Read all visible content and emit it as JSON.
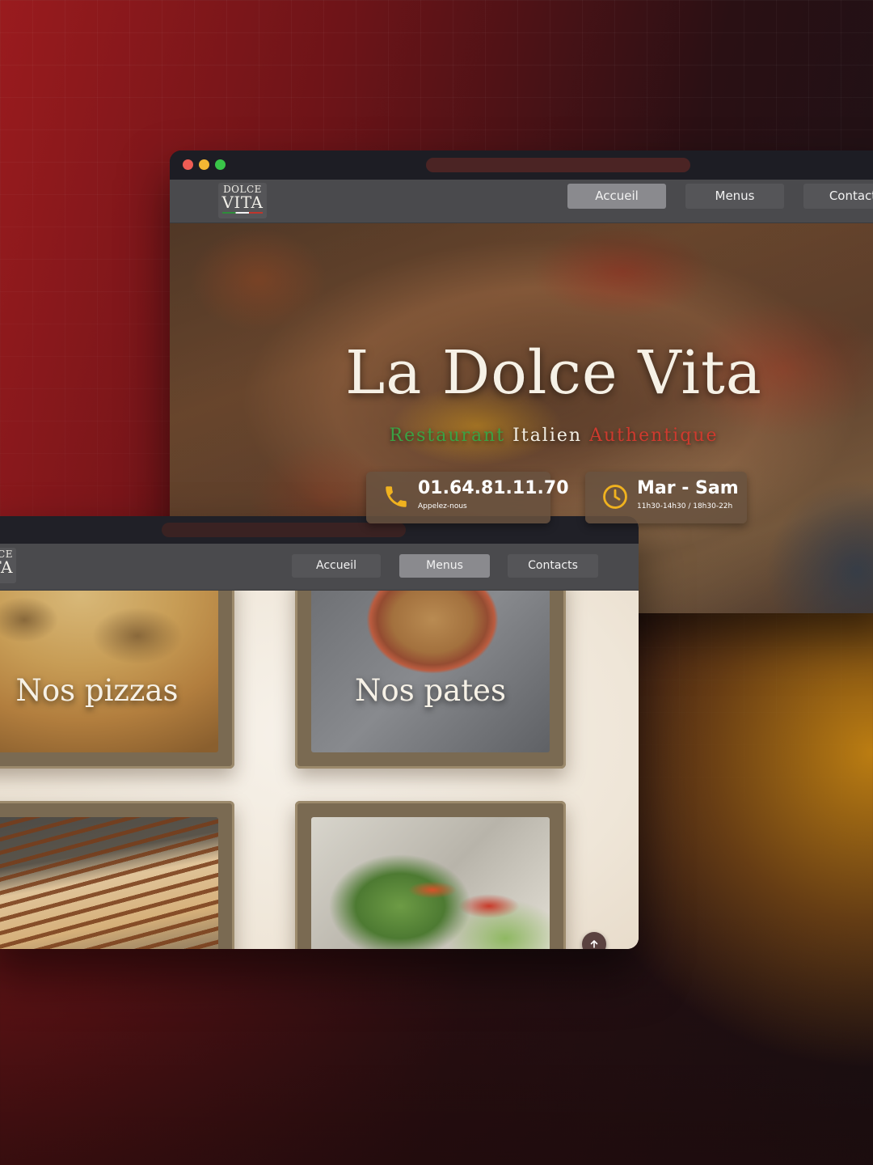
{
  "colors": {
    "accent_green": "#3aa244",
    "accent_red": "#cf3a2e",
    "nav_active": "#8a8a8e",
    "nav_bg": "#4a4a4d"
  },
  "window_home": {
    "logo": {
      "line1": "DOLCE",
      "line2": "VITA"
    },
    "nav": [
      {
        "label": "Accueil",
        "active": true
      },
      {
        "label": "Menus",
        "active": false
      },
      {
        "label": "Contact",
        "active": false
      }
    ],
    "hero": {
      "title": "La Dolce Vita",
      "subtitle": {
        "part1": "Restaurant",
        "part2": "Italien",
        "part3": "Authentique"
      }
    },
    "phone": {
      "icon": "phone-icon",
      "number": "01.64.81.11.70",
      "caption": "Appelez-nous"
    },
    "hours": {
      "icon": "clock-icon",
      "days": "Mar - Sam",
      "times": "11h30-14h30 / 18h30-22h"
    }
  },
  "window_menus": {
    "logo": {
      "line1": "CE",
      "line2": "TA"
    },
    "nav": [
      {
        "label": "Accueil",
        "active": false
      },
      {
        "label": "Menus",
        "active": true
      },
      {
        "label": "Contacts",
        "active": false
      }
    ],
    "cards": [
      {
        "caption": "Nos pizzas"
      },
      {
        "caption": "Nos pates"
      },
      {
        "caption": ""
      },
      {
        "caption": ""
      }
    ],
    "scroll_top_icon": "arrow-up-icon"
  }
}
